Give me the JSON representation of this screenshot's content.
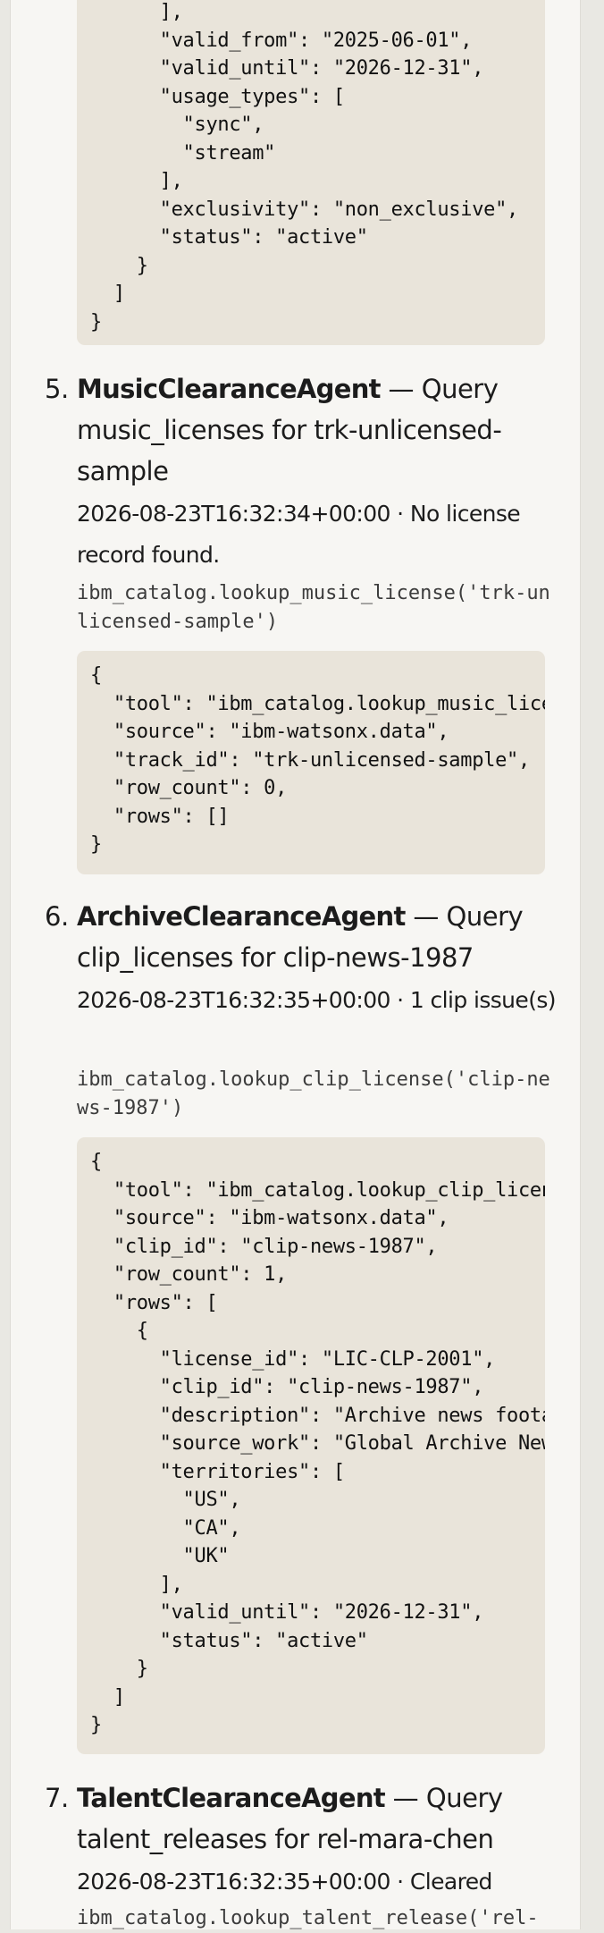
{
  "prev_step": {
    "json": "      ],\n      \"valid_from\": \"2025-06-01\",\n      \"valid_until\": \"2026-12-31\",\n      \"usage_types\": [\n        \"sync\",\n        \"stream\"\n      ],\n      \"exclusivity\": \"non_exclusive\",\n      \"status\": \"active\"\n    }\n  ]\n}"
  },
  "steps": [
    {
      "number": "5.",
      "agent": "MusicClearanceAgent",
      "action": " — Query music_licenses for trk-unlicensed-sample",
      "meta": "2026-08-23T16:32:34+00:00 · No license record found.",
      "call": "ibm_catalog.lookup_music_license('trk-unlicensed-sample')",
      "json": "{\n  \"tool\": \"ibm_catalog.lookup_music_license\",\n  \"source\": \"ibm-watsonx.data\",\n  \"track_id\": \"trk-unlicensed-sample\",\n  \"row_count\": 0,\n  \"rows\": []\n}"
    },
    {
      "number": "6.",
      "agent": "ArchiveClearanceAgent",
      "action": " — Query clip_licenses for clip-news-1987",
      "meta": "2026-08-23T16:32:35+00:00 · 1 clip issue(s)",
      "call": "ibm_catalog.lookup_clip_license('clip-news-1987')",
      "json": "{\n  \"tool\": \"ibm_catalog.lookup_clip_license\",\n  \"source\": \"ibm-watsonx.data\",\n  \"clip_id\": \"clip-news-1987\",\n  \"row_count\": 1,\n  \"rows\": [\n    {\n      \"license_id\": \"LIC-CLP-2001\",\n      \"clip_id\": \"clip-news-1987\",\n      \"description\": \"Archive news footage\",\n      \"source_work\": \"Global Archive News\",\n      \"territories\": [\n        \"US\",\n        \"CA\",\n        \"UK\"\n      ],\n      \"valid_until\": \"2026-12-31\",\n      \"status\": \"active\"\n    }\n  ]\n}"
    },
    {
      "number": "7.",
      "agent": "TalentClearanceAgent",
      "action": " — Query talent_releases for rel-mara-chen",
      "meta": "2026-08-23T16:32:35+00:00 · Cleared",
      "call": "ibm_catalog.lookup_talent_release('rel-"
    }
  ]
}
